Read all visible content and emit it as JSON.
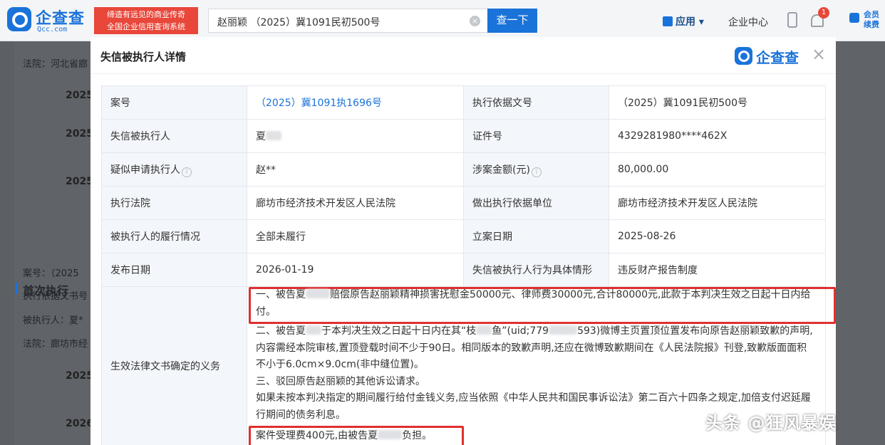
{
  "topbar": {
    "logo_text": "企查查",
    "logo_sub": "Qcc.com",
    "slogan_line1": "缔造有远见的商业传奇",
    "slogan_line2": "全国企业信用查询系统",
    "search_value": "赵丽颖 （2025）冀1091民初500号",
    "search_button": "查一下",
    "nav_app": "应用",
    "nav_center": "企业中心",
    "notification_count": "1",
    "vip_line1": "会员",
    "vip_line2": "续费"
  },
  "background_page": {
    "court_label": "法院：河北省廊",
    "years": [
      "2025",
      "2025",
      "2025",
      "2025",
      "2026"
    ],
    "section_title": "首次执行",
    "case_label": "案号：（2025",
    "basis_label": "执行依据文书号",
    "executed_label": "被执行人：夏*",
    "court_label2": "法院：廊坊市经"
  },
  "modal": {
    "title": "失信被执行人详情",
    "logo_text": "企查查",
    "rows": [
      {
        "l1": "案号",
        "v1": "（2025）冀1091执1696号",
        "l2": "执行依据文号",
        "v2": "（2025）冀1091民初500号"
      },
      {
        "l1": "失信被执行人",
        "v1": "夏",
        "l2": "证件号",
        "v2": "4329281980****462X"
      },
      {
        "l1": "疑似申请执行人",
        "v1": "赵**",
        "l2": "涉案金额(元)",
        "v2": "80,000.00"
      },
      {
        "l1": "执行法院",
        "v1": "廊坊市经济技术开发区人民法院",
        "l2": "做出执行依据单位",
        "v2": "廊坊市经济技术开发区人民法院"
      },
      {
        "l1": "被执行人的履行情况",
        "v1": "全部未履行",
        "l2": "立案日期",
        "v2": "2025-08-26"
      },
      {
        "l1": "发布日期",
        "v1": "2026-01-19",
        "l2": "失信被执行人行为具体情形",
        "v2": "违反财产报告制度"
      }
    ],
    "obligation_label": "生效法律文书确定的义务",
    "obligation": {
      "p1_a": "一、被告夏",
      "p1_b": "赔偿原告赵丽颖精神损害抚慰金50000元、律师费30000元,合计80000元,此款于本判决生效之日起十日内给付。",
      "p2_a": "二、被告夏",
      "p2_b": "于本判决生效之日起十日内在其“枝",
      "p2_c": "鱼”(uid;779",
      "p2_d": "593)微博主页置顶位置发布向原告赵丽颖致歉的声明,内容需经本院审核,置顶登载时间不少于90日。相同版本的致歉声明,还应在微博致歉期间在《人民法院报》刊登,致歉版面面积不小于6.0cm×9.0cm(非中缝位置)。",
      "p3": "三、驳回原告赵丽颖的其他诉讼请求。",
      "p4": "如果未按本判决指定的期间履行给付金钱义务,应当依照《中华人民共和国民事诉讼法》第二百六十四条之规定,加倍支付迟延履行期间的债务利息。",
      "p5_a": "案件受理费400元,由被告夏",
      "p5_b": "负担。"
    }
  },
  "watermark": "头条 @狂风暴娱",
  "colors": {
    "brand": "#1a73d9",
    "highlight": "#e0302f"
  }
}
